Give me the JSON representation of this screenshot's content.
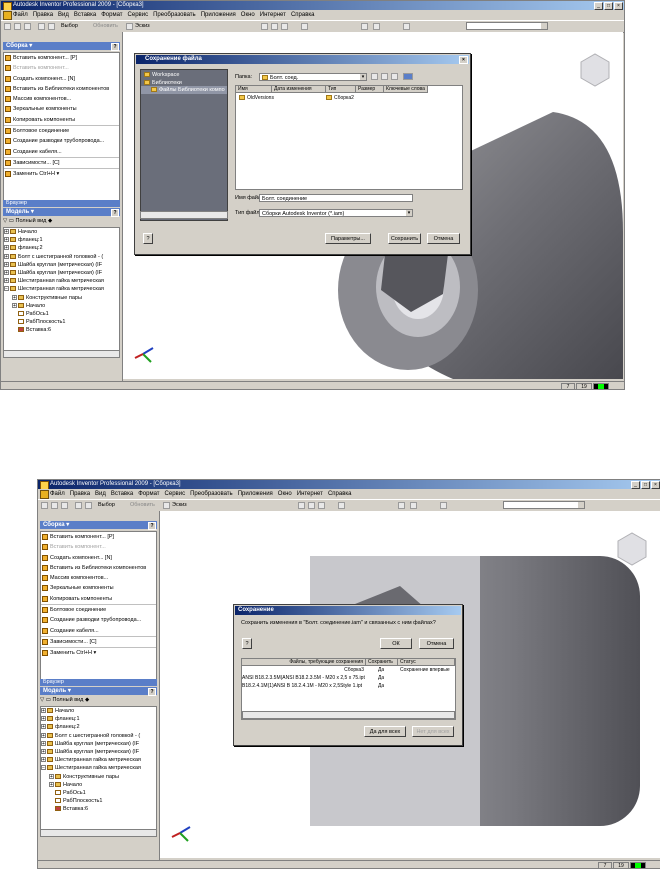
{
  "app": {
    "title": "Autodesk Inventor Professional 2009 - [Сборка3]",
    "menu": [
      "Файл",
      "Правка",
      "Вид",
      "Вставка",
      "Формат",
      "Сервис",
      "Преобразовать",
      "Приложения",
      "Окно",
      "Интернет",
      "Справка"
    ],
    "toolbar": {
      "select": "Выбор",
      "sketch": "Эскиз",
      "update": "Обновить"
    }
  },
  "panel": {
    "header": "Сборка ▾",
    "items": [
      "Вставить компонент... [P]",
      "Вставить компонент...",
      "Создать компонент... [N]",
      "Вставить из Библиотеки компонентов",
      "Массив компонентов...",
      "Зеркальные компоненты",
      "Копировать компоненты",
      "Болтовое соединение",
      "Создание разводки трубопровода...",
      "Создание кабеля...",
      "Зависимости... [C]",
      "Заменить Ctrl+H ▾"
    ]
  },
  "browser": {
    "header": "Браузер",
    "model_label": "Модель ▾",
    "view": "Полный вид",
    "tree": [
      {
        "label": "Начало",
        "indent": 0
      },
      {
        "label": "фланец:1",
        "indent": 0
      },
      {
        "label": "фланец:2",
        "indent": 0
      },
      {
        "label": "Болт с шестигранной головкой - (",
        "indent": 0
      },
      {
        "label": "Шайба круглая (метрическая) (IF",
        "indent": 0
      },
      {
        "label": "Шайба круглая (метрическая) (IF",
        "indent": 0
      },
      {
        "label": "Шестигранная гайка метрическая",
        "indent": 0
      },
      {
        "label": "Шестигранная гайка метрическая",
        "indent": 0
      },
      {
        "label": "Конструктивные пары",
        "indent": 1
      },
      {
        "label": "Начало",
        "indent": 1
      },
      {
        "label": "РабОсь1",
        "indent": 1
      },
      {
        "label": "РабПлоскость1",
        "indent": 1
      },
      {
        "label": "Вставка:6",
        "indent": 1
      }
    ]
  },
  "status": {
    "count1": "7",
    "count2": "19"
  },
  "save_file_dialog": {
    "title": "Сохранение файла",
    "places": [
      "Workspace",
      "Библиотеки",
      "Файлы Библиотеки компо"
    ],
    "folder_label": "Папка:",
    "folder_value": "Болт. соед.",
    "columns": [
      "Имя",
      "Дата изменения",
      "Тип",
      "Размер",
      "Ключевые слова"
    ],
    "files": [
      "OldVersions",
      "Сборка2"
    ],
    "filename_label": "Имя файла:",
    "filename_value": "Болт. соединение",
    "filetype_label": "Тип файла:",
    "filetype_value": "Сборки Autodesk Inventor (*.iam)",
    "params_button": "Параметры...",
    "save_button": "Сохранить",
    "cancel_button": "Отмена"
  },
  "save_confirm_dialog": {
    "title": "Сохранение",
    "message": "Сохранить изменения в \"Болт. соединение.iam\" и связанных с ним файлах?",
    "ok_button": "ОК",
    "cancel_button": "Отмена",
    "columns": [
      "Файлы, требующие сохранения",
      "Сохранить",
      "Статус"
    ],
    "rows": [
      {
        "file": "Сборка3",
        "save": "Да",
        "status": "Сохранение впервые"
      },
      {
        "file": "ANSI B18.2.3.5M(ANSI B18.2.3.5M - M20 x 2,5 x 75.ipt",
        "save": "Да",
        "status": ""
      },
      {
        "file": "B18.2.4.1M(1)ANSI B 18.2.4.1M - M20 x 2,5Style 1.ipt",
        "save": "Да",
        "status": ""
      }
    ],
    "yes_all_button": "Да для всех",
    "no_all_button": "Нет для всех"
  }
}
